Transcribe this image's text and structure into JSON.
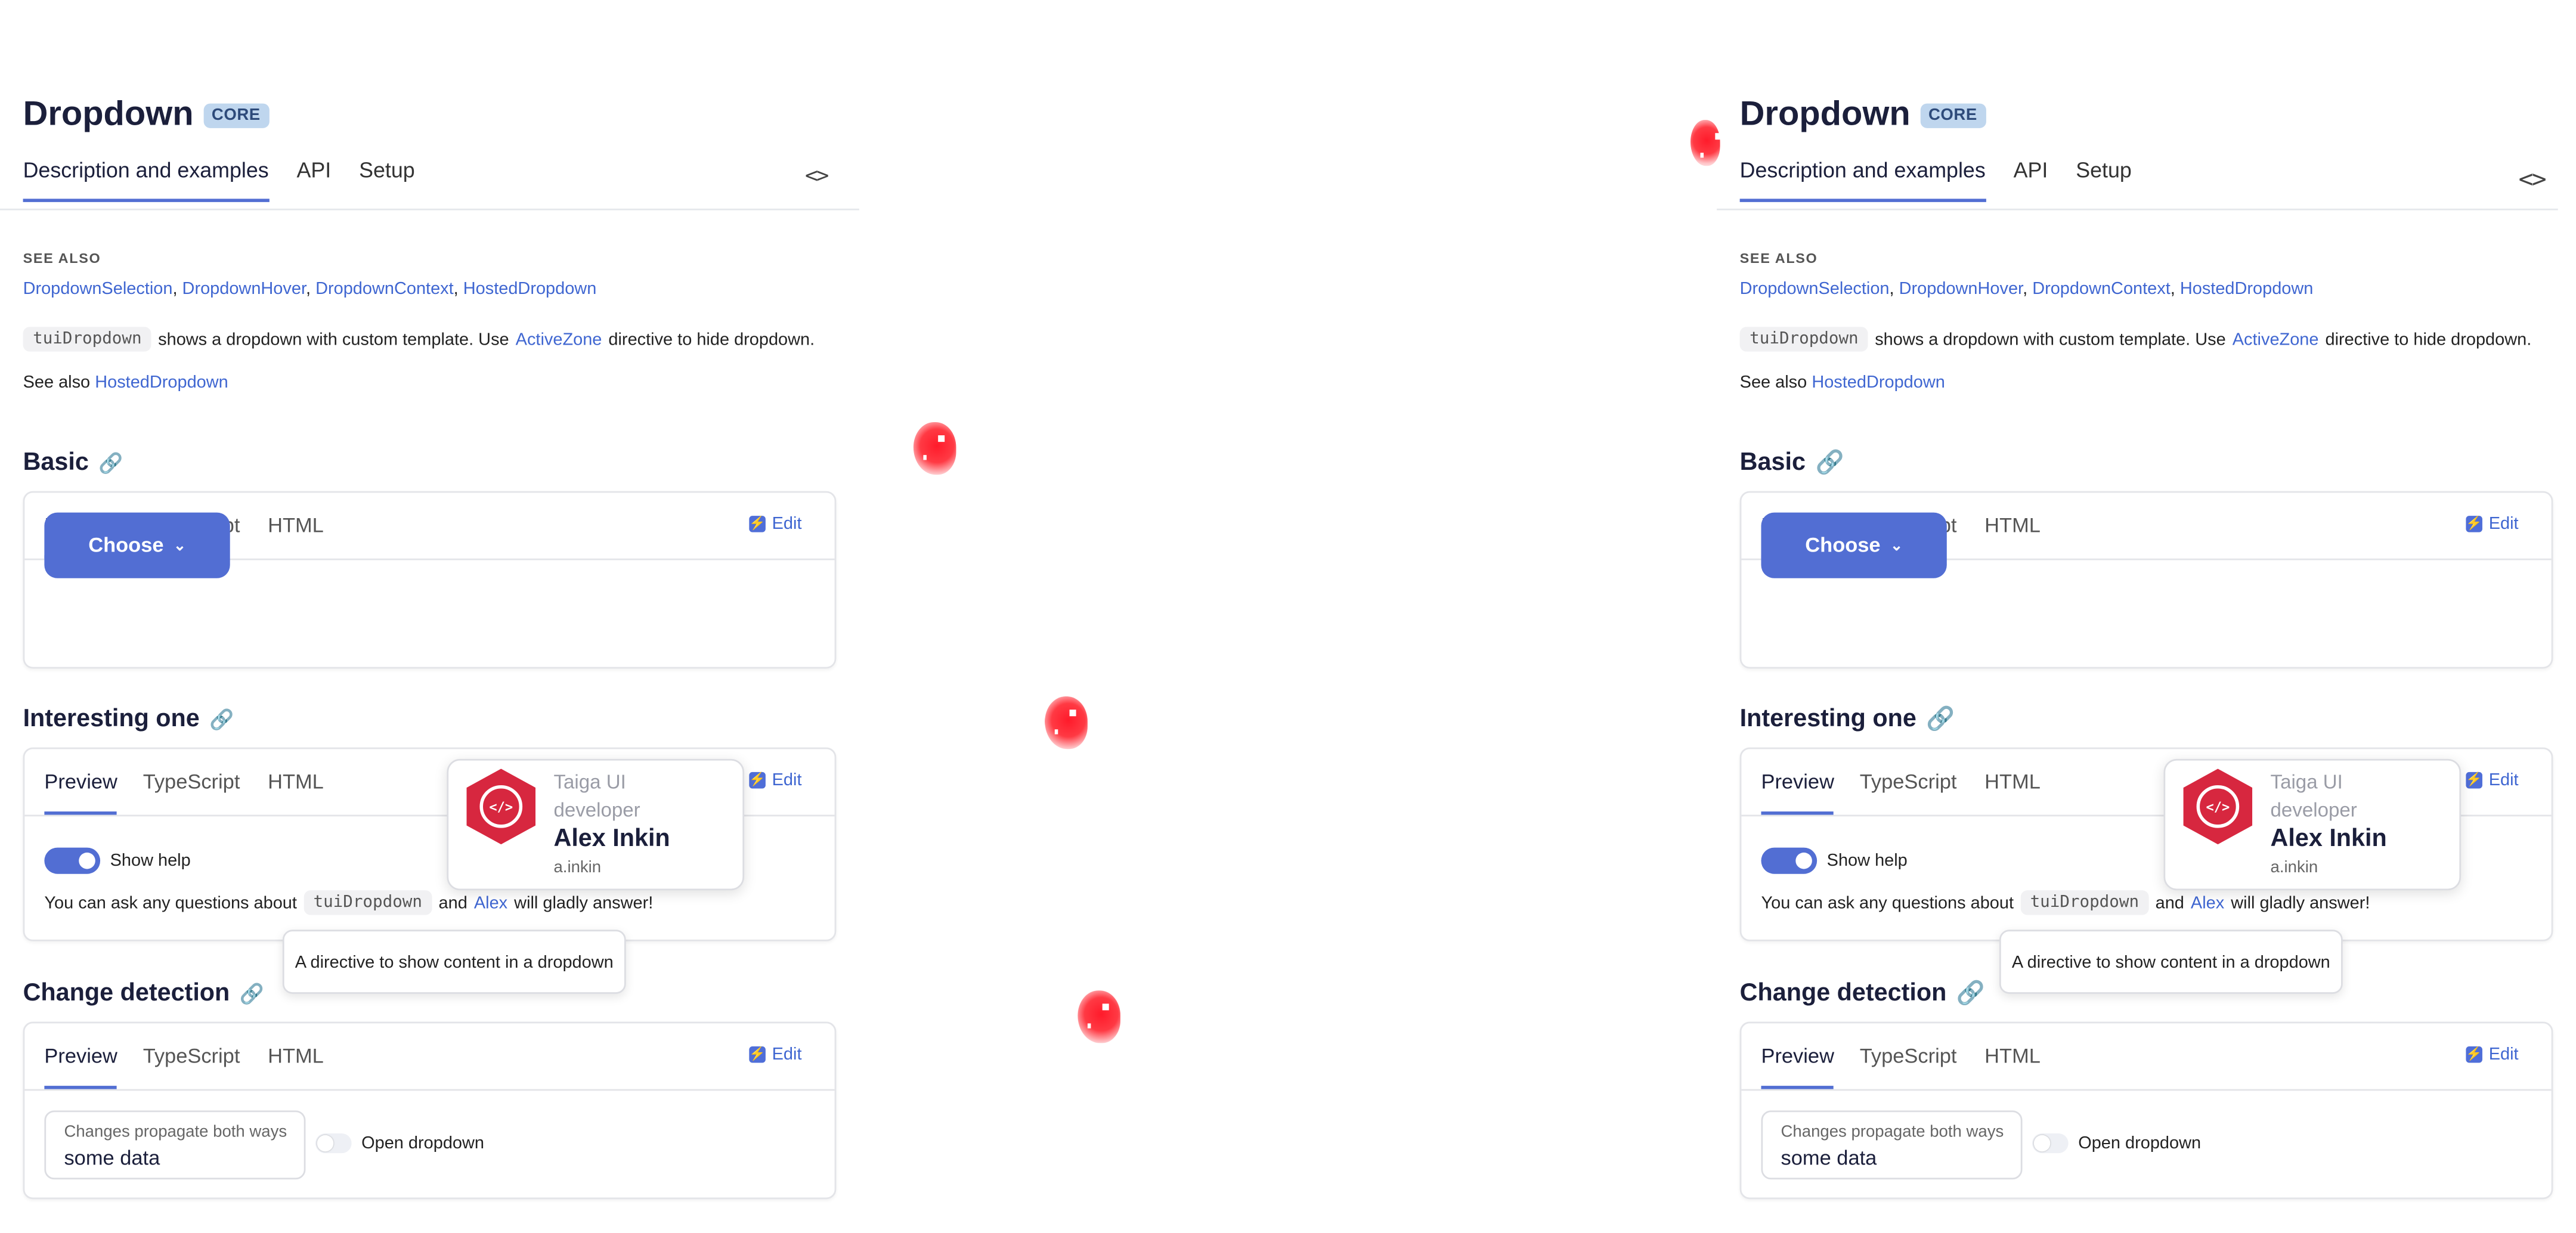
{
  "header": {
    "title": "Dropdown",
    "badge": "CORE",
    "tabs": [
      "Description and examples",
      "API",
      "Setup"
    ],
    "code_toggle": "<>"
  },
  "see_also": {
    "heading": "SEE ALSO",
    "links": [
      "DropdownSelection",
      "DropdownHover",
      "DropdownContext",
      "HostedDropdown"
    ]
  },
  "description": {
    "code": "tuiDropdown",
    "text_before": "shows a dropdown with custom template. Use",
    "link": "ActiveZone",
    "text_after": "directive to hide dropdown.",
    "see_also_prefix": "See also",
    "see_also_link": "HostedDropdown"
  },
  "card_tabs": [
    "Preview",
    "TypeScript",
    "HTML"
  ],
  "edit_label": "Edit",
  "sections": {
    "basic": {
      "title": "Basic",
      "button": "Choose"
    },
    "interesting": {
      "title": "Interesting one",
      "toggle_label": "Show help",
      "ask_prefix": "You can ask any questions about",
      "ask_code": "tuiDropdown",
      "ask_and": "and",
      "ask_link": "Alex",
      "ask_suffix": "will gladly answer!",
      "popup": {
        "role": "Taiga UI developer",
        "name": "Alex Inkin",
        "username": "a.inkin"
      },
      "tooltip": "A directive to show content in a dropdown"
    },
    "change": {
      "title": "Change detection",
      "field_label": "Changes propagate both ways",
      "field_value": "some data",
      "toggle_label": "Open dropdown"
    }
  },
  "colors": {
    "accent": "#526ed3",
    "link": "#3f66d1",
    "badge_bg": "#bfd6ee",
    "avatar": "#d7273f",
    "marker": "#ff1b2b"
  }
}
